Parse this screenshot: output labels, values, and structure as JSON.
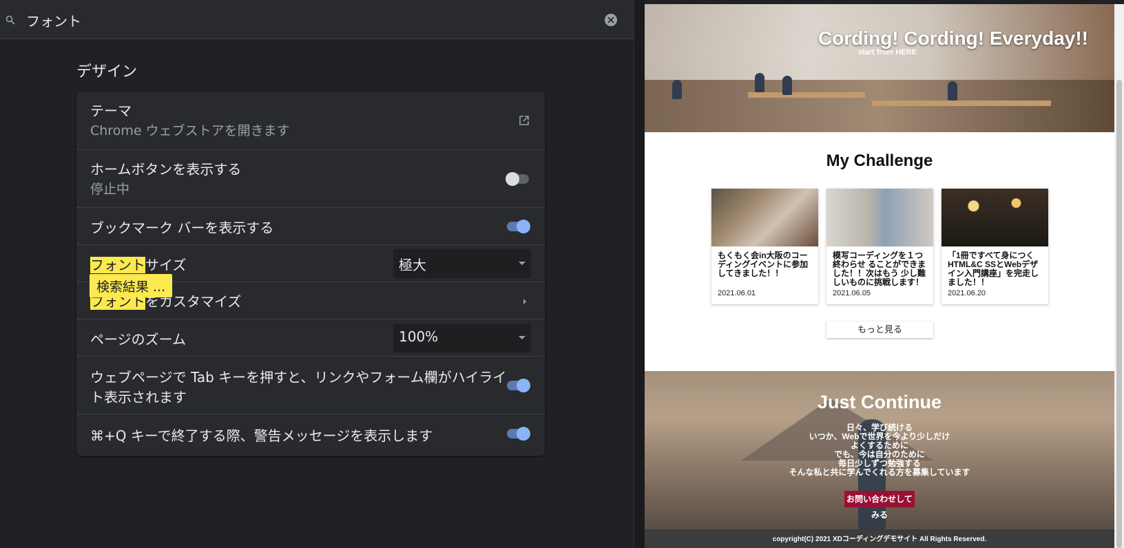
{
  "search": {
    "query": "フォント"
  },
  "section": {
    "title": "デザイン"
  },
  "rows": {
    "theme": {
      "label": "テーマ",
      "sub": "Chrome ウェブストアを開きます"
    },
    "home_button": {
      "label": "ホームボタンを表示する",
      "sub": "停止中",
      "state": "off"
    },
    "bookmark_bar": {
      "label": "ブックマーク バーを表示する",
      "state": "on"
    },
    "font_size": {
      "label_hl": "フォント",
      "label_rest": "サイズ",
      "value": "極大"
    },
    "customize_fonts": {
      "label_hl": "フォント",
      "label_rest": "をカスタマイズ"
    },
    "page_zoom": {
      "label": "ページのズーム",
      "value": "100%"
    },
    "tab_highlight": {
      "label_line1": "ウェブページで Tab キーを押すと、リンクやフォーム欄がハイライ",
      "label_line2": "ト表示されます",
      "state": "on"
    },
    "quit_warning": {
      "label": "⌘+Q キーで終了する際、警告メッセージを表示します",
      "state": "on"
    }
  },
  "search_bubble": "検索結果 ...",
  "colors": {
    "highlight": "#fce94f",
    "toggle_on": "#8ab4f8",
    "accent_button": "#9a1035"
  },
  "site": {
    "hero_title": "Cording! Cording! Everyday!!",
    "hero_sub": "start from HERE",
    "challenge_title": "My Challenge",
    "posts": [
      {
        "title": "もくもく会in大阪のコーディングイベントに参加してきました！！",
        "date": "2021.06.01"
      },
      {
        "title": "模写コーディングを１つ終わらせ ることができました！！次はもう 少し難しいものに挑戦します！",
        "date": "2021.06.05"
      },
      {
        "title": "「1冊ですべて身につくHTML&C SSとWebデザイン入門講座」を完走しました！！",
        "date": "2021.06.20"
      }
    ],
    "more_button": "もっと見る",
    "continue_title": "Just Continue",
    "continue_lines": [
      "日々、学び続ける",
      "いつか、Webで世界を今より少しだけ",
      "よくするために",
      "でも、今は自分のために",
      "毎日少しずつ勉強する",
      "そんな私と共に学んでくれる方を募集しています"
    ],
    "contact_button_line1": "お問い合わせして",
    "contact_button_line2": "みる",
    "footer": "copyright(C) 2021 XDコーディングデモサイト All Rights Reserved."
  }
}
